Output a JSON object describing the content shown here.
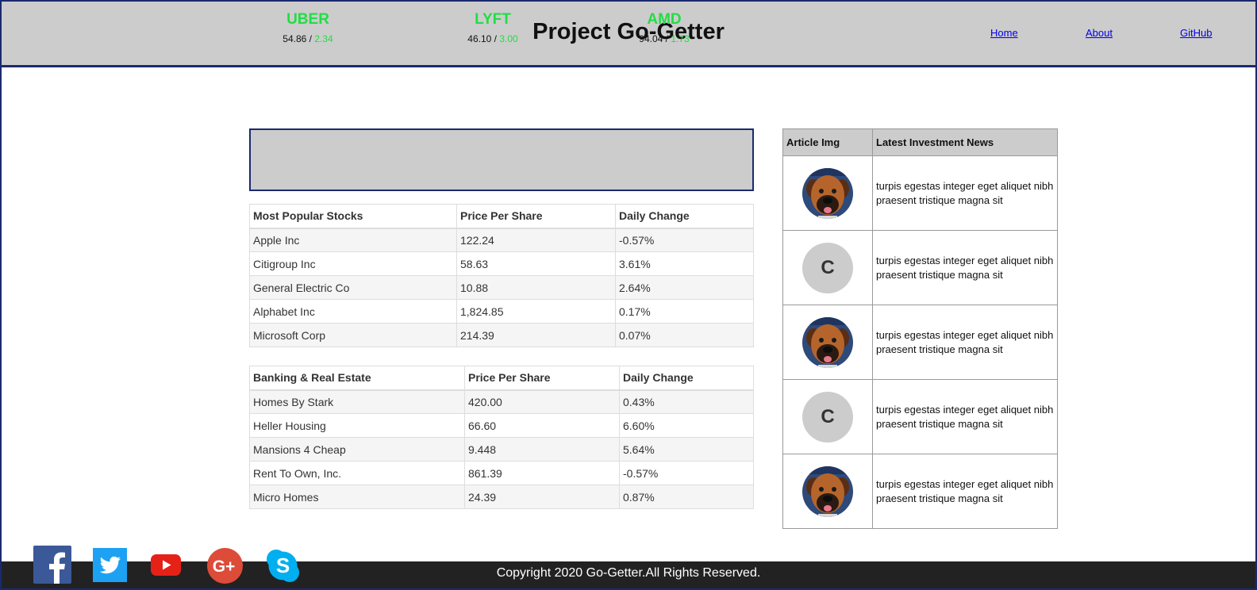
{
  "header": {
    "title": "Project Go-Getter",
    "nav": {
      "home": "Home",
      "about": "About",
      "github": "GitHub"
    }
  },
  "ticker": [
    {
      "symbol": "UBER",
      "price": "54.86",
      "sep": " / ",
      "change": "2.34"
    },
    {
      "symbol": "LYFT",
      "price": "46.10",
      "sep": " / ",
      "change": "3.00"
    },
    {
      "symbol": "AMD",
      "price": "94.04",
      "sep": " / ",
      "change": "1.73"
    }
  ],
  "popular": {
    "headers": [
      "Most Popular Stocks",
      "Price Per Share",
      "Daily Change"
    ],
    "rows": [
      [
        "Apple Inc",
        "122.24",
        "-0.57%"
      ],
      [
        "Citigroup Inc",
        "58.63",
        "3.61%"
      ],
      [
        "General Electric Co",
        "10.88",
        "2.64%"
      ],
      [
        "Alphabet Inc",
        "1,824.85",
        "0.17%"
      ],
      [
        "Microsoft Corp",
        "214.39",
        "0.07%"
      ]
    ]
  },
  "banking": {
    "headers": [
      "Banking & Real Estate",
      "Price Per Share",
      "Daily Change"
    ],
    "rows": [
      [
        "Homes By Stark",
        "420.00",
        "0.43%"
      ],
      [
        "Heller Housing",
        "66.60",
        "6.60%"
      ],
      [
        "Mansions 4 Cheap",
        "9.448",
        "5.64%"
      ],
      [
        "Rent To Own, Inc.",
        "861.39",
        "-0.57%"
      ],
      [
        "Micro Homes",
        "24.39",
        "0.87%"
      ]
    ]
  },
  "news": {
    "headers": [
      "Article Img",
      "Latest Investment News"
    ],
    "items": [
      {
        "image": "dog-photo",
        "letter": "",
        "text": "turpis egestas integer eget aliquet nibh praesent tristique magna sit"
      },
      {
        "image": "letter-avatar",
        "letter": "C",
        "text": "turpis egestas integer eget aliquet nibh praesent tristique magna sit"
      },
      {
        "image": "dog-photo",
        "letter": "",
        "text": "turpis egestas integer eget aliquet nibh praesent tristique magna sit"
      },
      {
        "image": "letter-avatar",
        "letter": "C",
        "text": "turpis egestas integer eget aliquet nibh praesent tristique magna sit"
      },
      {
        "image": "dog-photo",
        "letter": "",
        "text": "turpis egestas integer eget aliquet nibh praesent tristique magna sit"
      }
    ]
  },
  "footer": {
    "copyright": "Copyright 2020 Go-Getter.All Rights Reserved.",
    "social_icons": [
      "facebook-icon",
      "twitter-icon",
      "youtube-icon",
      "google-plus-icon",
      "skype-icon"
    ]
  },
  "colors": {
    "header_bg": "#cccccc",
    "border_navy": "#1a2a6e",
    "ticker_green": "#22dd44",
    "footer_bg": "#222222",
    "link_blue": "#0000ee"
  }
}
